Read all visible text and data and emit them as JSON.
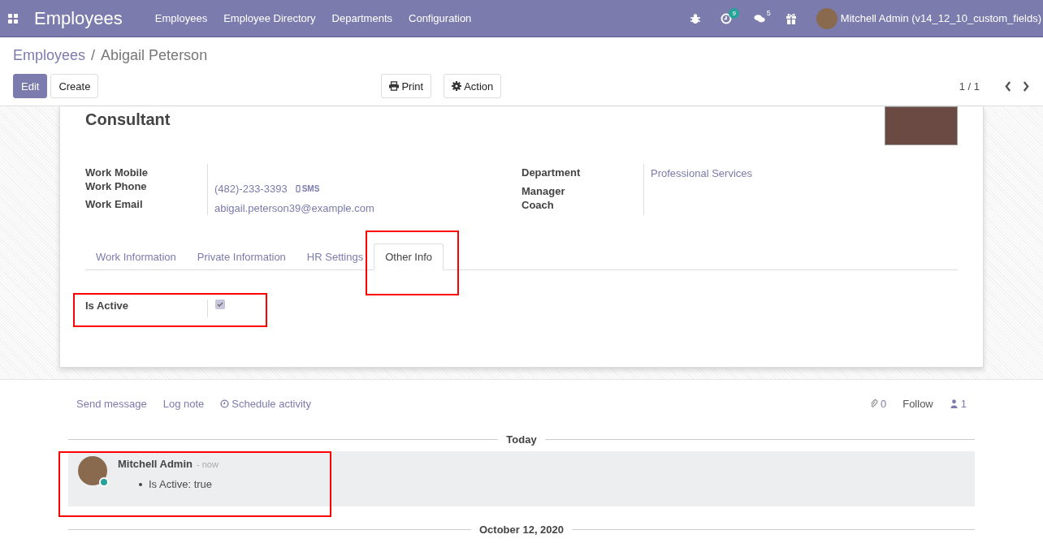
{
  "navbar": {
    "app_title": "Employees",
    "menu": [
      "Employees",
      "Employee Directory",
      "Departments",
      "Configuration"
    ],
    "activity_count": "9",
    "message_count": "5",
    "user": "Mitchell Admin (v14_12_10_custom_fields)"
  },
  "breadcrumb": {
    "parent": "Employees",
    "separator": "/",
    "current": "Abigail Peterson"
  },
  "buttons": {
    "edit": "Edit",
    "create": "Create",
    "print": "Print",
    "action": "Action"
  },
  "pager": "1 / 1",
  "form": {
    "job_title": "Consultant",
    "left_fields": [
      {
        "label": "Work Mobile"
      },
      {
        "label": "Work Phone",
        "value": "(482)-233-3393",
        "sms": "SMS"
      },
      {
        "label": "Work Email",
        "value": "abigail.peterson39@example.com"
      }
    ],
    "right_fields": [
      {
        "label": "Department",
        "value": "Professional Services"
      },
      {
        "label": "Manager"
      },
      {
        "label": "Coach"
      }
    ],
    "tabs": [
      {
        "label": "Work Information",
        "selected": false
      },
      {
        "label": "Private Information",
        "selected": false
      },
      {
        "label": "HR Settings",
        "selected": false
      },
      {
        "label": "Other Info",
        "selected": true
      }
    ],
    "tab_fields": [
      {
        "label": "Is Active",
        "checked": true
      }
    ]
  },
  "chatter": {
    "actions": [
      {
        "label": "Send message",
        "kind": "plain"
      },
      {
        "label": "Log note",
        "kind": "plain"
      },
      {
        "label": "Schedule activity",
        "kind": "clock"
      }
    ],
    "attachments": "0",
    "follow": "Follow",
    "followers": "1",
    "dates": [
      "Today",
      "October 12, 2020"
    ],
    "message": {
      "author": "Mitchell Admin",
      "time": "- now",
      "changes": [
        "Is Active: true"
      ]
    }
  }
}
